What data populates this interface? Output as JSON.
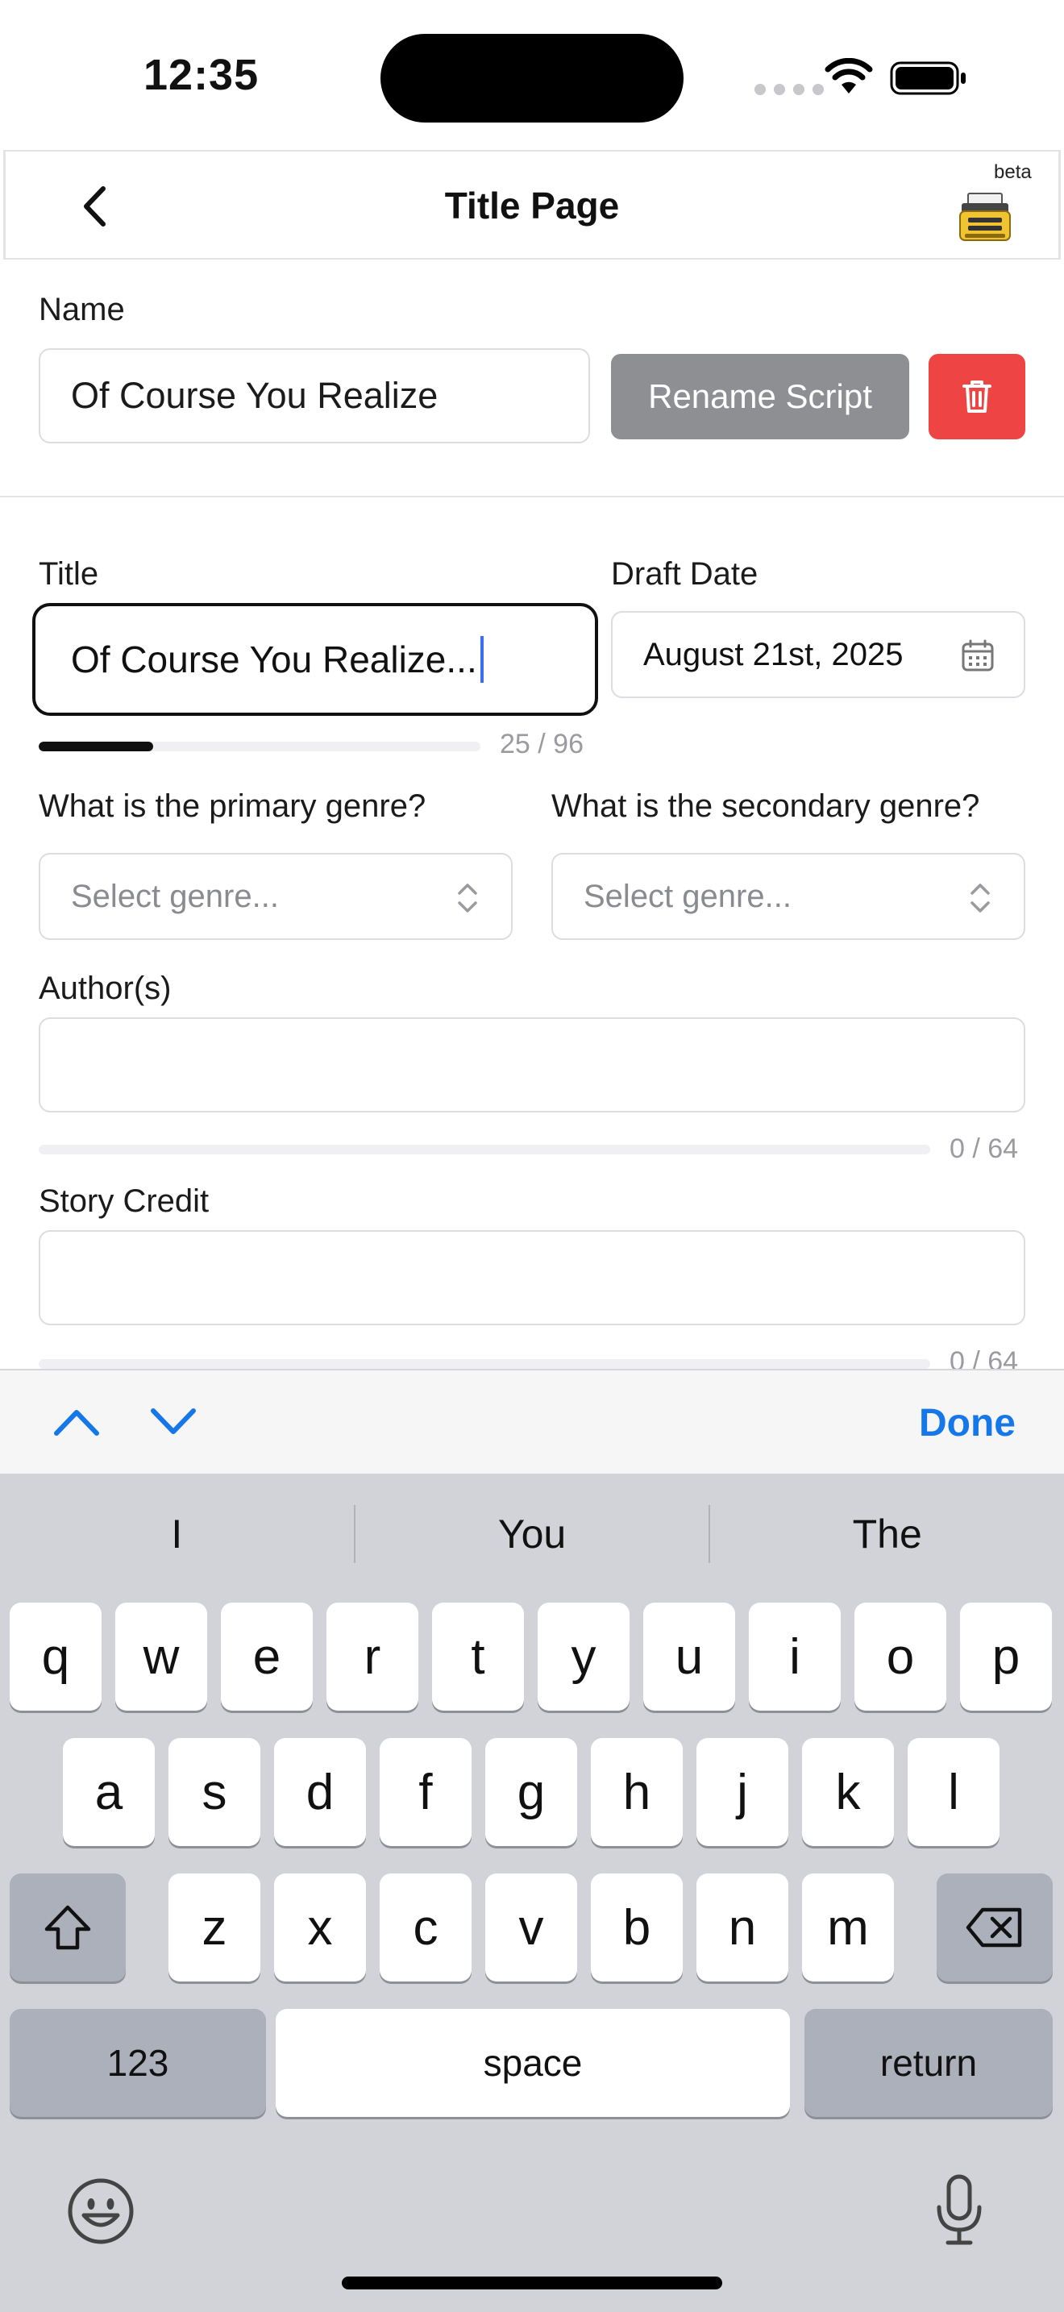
{
  "status_bar": {
    "time": "12:35"
  },
  "header": {
    "title": "Title Page",
    "badge": "beta"
  },
  "name_section": {
    "label": "Name",
    "value": "Of Course You Realize",
    "rename_label": "Rename Script"
  },
  "title_field": {
    "label": "Title",
    "value": "Of Course You Realize...",
    "count": "25 / 96",
    "progress": 0.26
  },
  "draft_date": {
    "label": "Draft Date",
    "value": "August 21st, 2025"
  },
  "primary_genre": {
    "label": "What is the primary genre?",
    "placeholder": "Select genre..."
  },
  "secondary_genre": {
    "label": "What is the secondary genre?",
    "placeholder": "Select genre..."
  },
  "authors": {
    "label": "Author(s)",
    "value": "",
    "count": "0 / 64",
    "progress": 0
  },
  "story_credit": {
    "label": "Story Credit",
    "value": "",
    "count": "0 / 64"
  },
  "accessory": {
    "done_label": "Done"
  },
  "keyboard": {
    "suggestions": [
      "I",
      "You",
      "The"
    ],
    "row1": [
      "q",
      "w",
      "e",
      "r",
      "t",
      "y",
      "u",
      "i",
      "o",
      "p"
    ],
    "row2": [
      "a",
      "s",
      "d",
      "f",
      "g",
      "h",
      "j",
      "k",
      "l"
    ],
    "row3": [
      "z",
      "x",
      "c",
      "v",
      "b",
      "n",
      "m"
    ],
    "numbers_label": "123",
    "space_label": "space",
    "return_label": "return"
  },
  "colors": {
    "accent": "#1677e8",
    "danger": "#ef4444",
    "rename_button": "#8e8f93",
    "keyboard_bg": "#d1d3d9"
  }
}
